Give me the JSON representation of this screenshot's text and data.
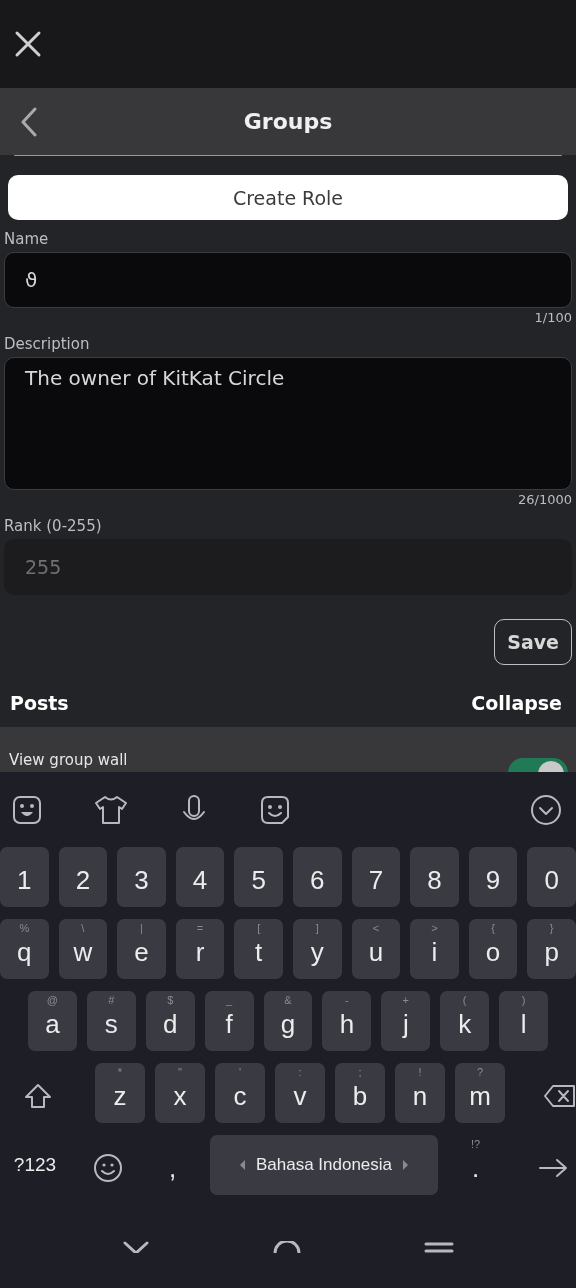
{
  "header": {
    "title": "Groups"
  },
  "create_role": {
    "label": "Create Role"
  },
  "fields": [
    {
      "kind": "input",
      "label": "Name",
      "value": "ϑ",
      "counter": "1/100"
    },
    {
      "kind": "textarea",
      "label": "Description",
      "value": "The owner of KitKat Circle",
      "counter": "26/1000"
    },
    {
      "kind": "input",
      "label": "Rank (0-255)",
      "placeholder": "255"
    }
  ],
  "save": {
    "label": "Save"
  },
  "section": {
    "title": "Posts",
    "action": "Collapse"
  },
  "permissions": [
    {
      "label": "View group wall",
      "on": true
    }
  ],
  "keyboard": {
    "number_row": [
      "1",
      "2",
      "3",
      "4",
      "5",
      "6",
      "7",
      "8",
      "9",
      "0"
    ],
    "rows": [
      [
        {
          "label": "q",
          "hint": "%"
        },
        {
          "label": "w",
          "hint": "\\"
        },
        {
          "label": "e",
          "hint": "|"
        },
        {
          "label": "r",
          "hint": "="
        },
        {
          "label": "t",
          "hint": "["
        },
        {
          "label": "y",
          "hint": "]"
        },
        {
          "label": "u",
          "hint": "<"
        },
        {
          "label": "i",
          "hint": ">"
        },
        {
          "label": "o",
          "hint": "{"
        },
        {
          "label": "p",
          "hint": "}"
        }
      ],
      [
        {
          "label": "a",
          "hint": "@"
        },
        {
          "label": "s",
          "hint": "#"
        },
        {
          "label": "d",
          "hint": "$"
        },
        {
          "label": "f",
          "hint": "_"
        },
        {
          "label": "g",
          "hint": "&"
        },
        {
          "label": "h",
          "hint": "-"
        },
        {
          "label": "j",
          "hint": "+"
        },
        {
          "label": "k",
          "hint": "("
        },
        {
          "label": "l",
          "hint": ")"
        }
      ],
      [
        {
          "label": "z",
          "hint": "*"
        },
        {
          "label": "x",
          "hint": "\""
        },
        {
          "label": "c",
          "hint": "'"
        },
        {
          "label": "v",
          "hint": ":"
        },
        {
          "label": "b",
          "hint": ";"
        },
        {
          "label": "n",
          "hint": "!"
        },
        {
          "label": "m",
          "hint": "?"
        }
      ]
    ],
    "symbols": "?123",
    "comma": ",",
    "space": "Bahasa Indonesia",
    "period": ".",
    "period_hint": "!?"
  }
}
